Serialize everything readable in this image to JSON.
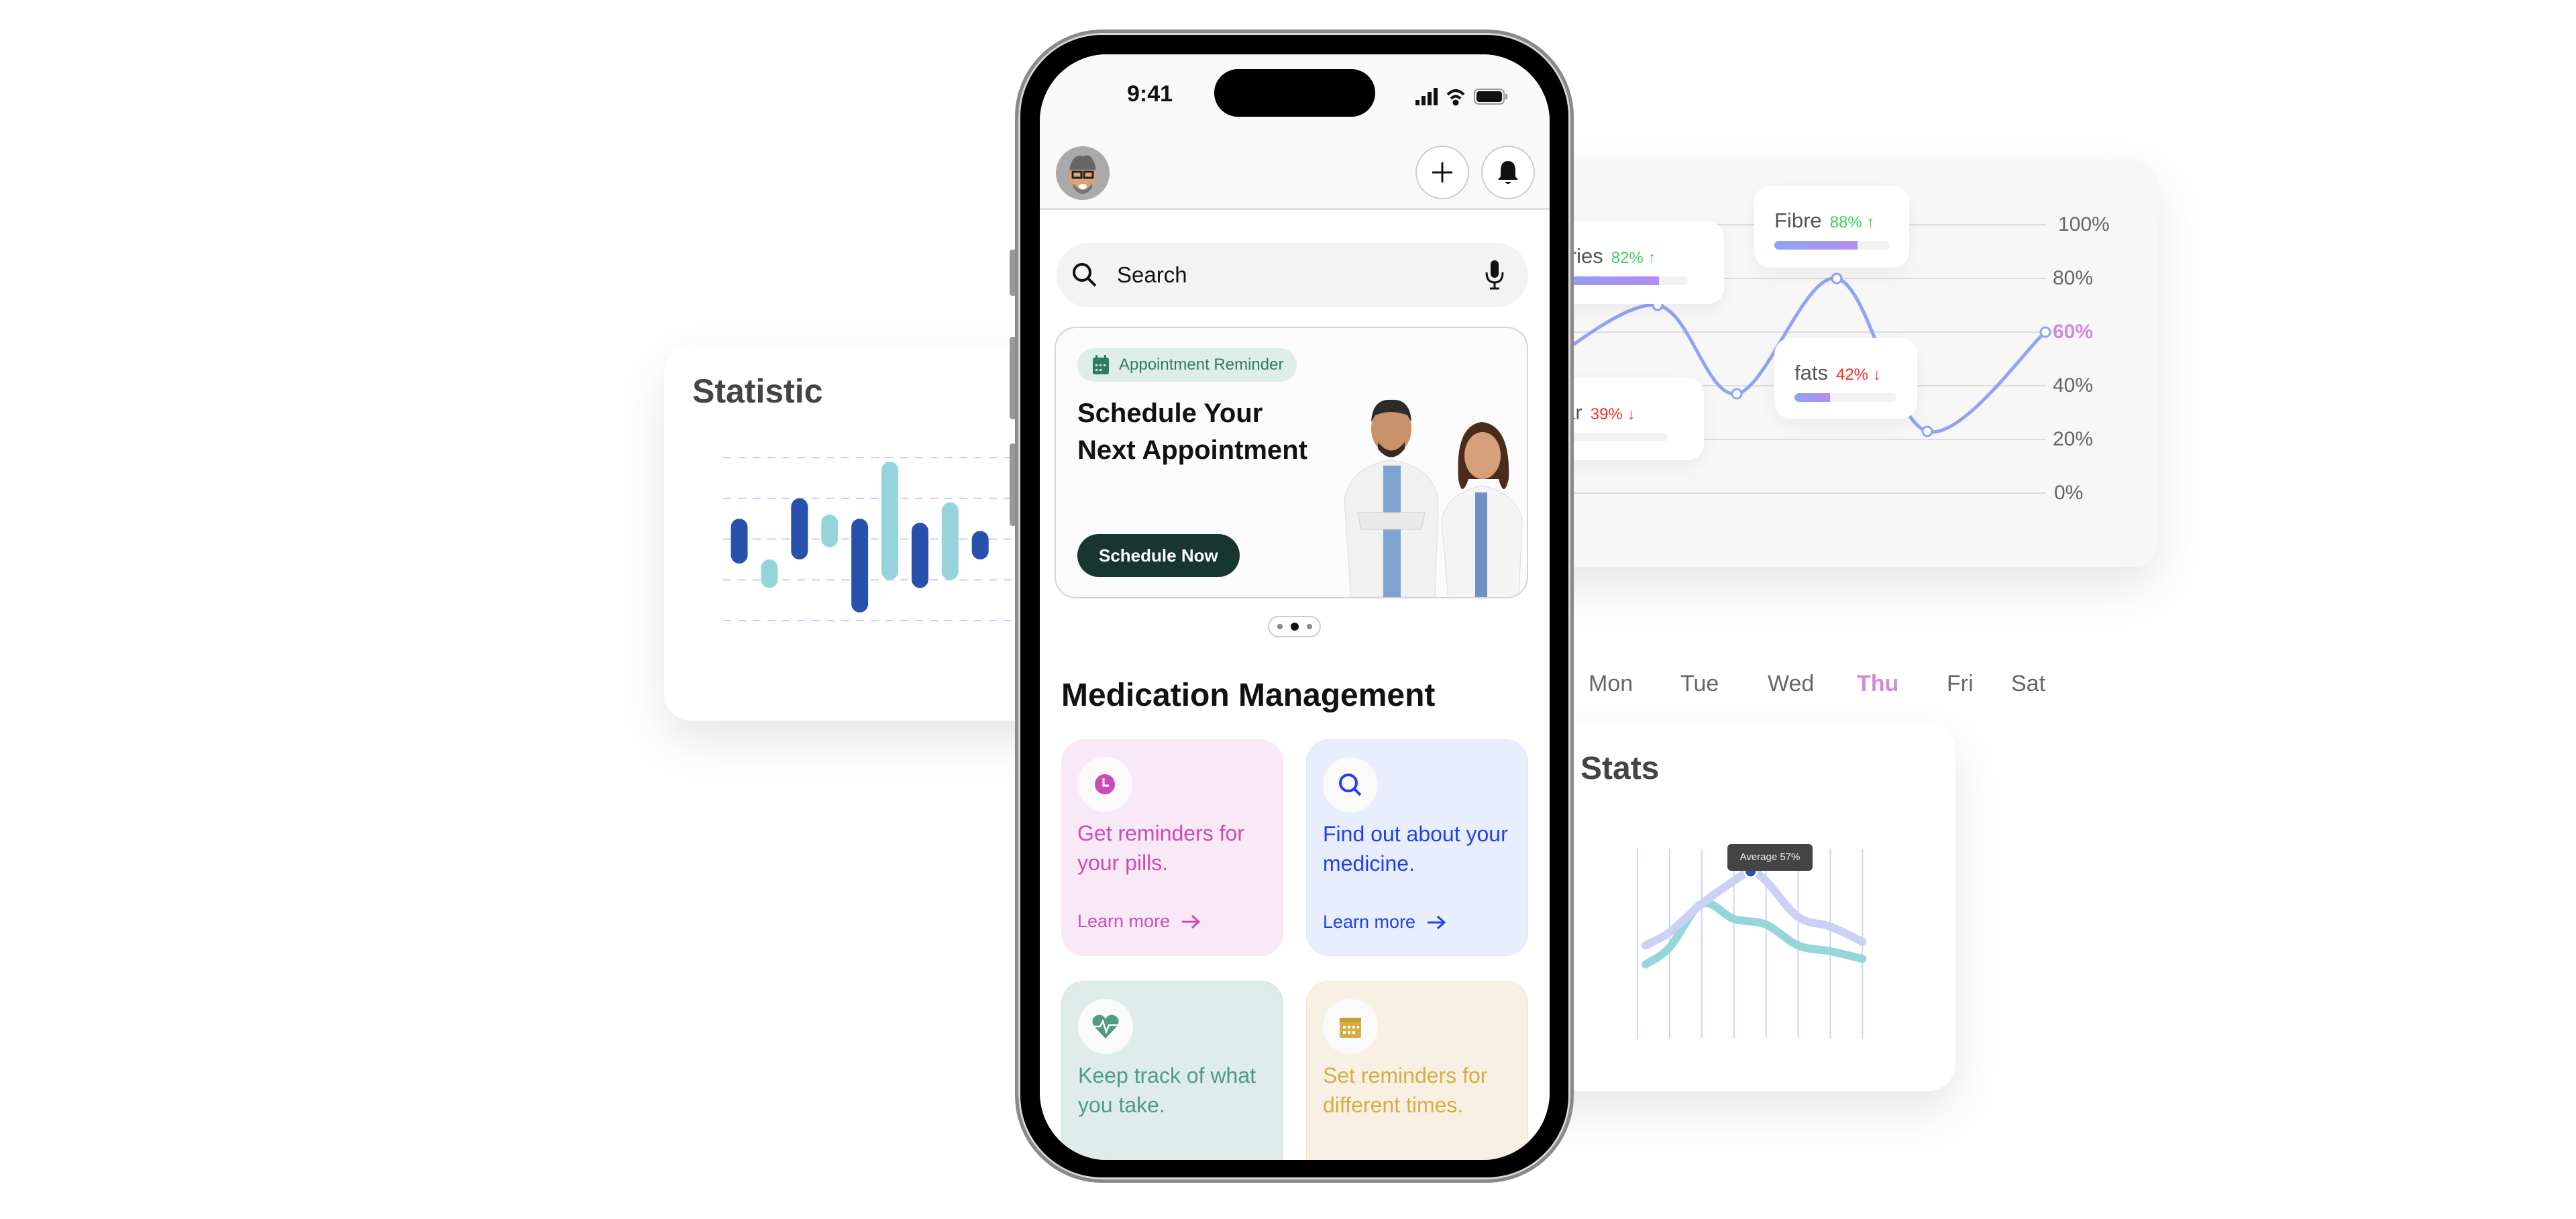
{
  "statistic_card": {
    "title": "Statistic",
    "chart_data": {
      "type": "bar",
      "subtype": "floating-range",
      "gridlines": 5,
      "grid": "dashed-horizontal",
      "colors": [
        "#2751ab",
        "#94d4da"
      ],
      "ranges": [
        [
          1.4,
          2.5
        ],
        [
          0.8,
          1.5
        ],
        [
          1.5,
          3.0
        ],
        [
          1.8,
          2.6
        ],
        [
          0.2,
          2.5
        ],
        [
          1.0,
          3.9
        ],
        [
          0.8,
          2.4
        ],
        [
          1.0,
          2.9
        ],
        [
          1.5,
          2.2
        ]
      ]
    }
  },
  "nutrition_card": {
    "chart_data": {
      "type": "line",
      "y_ticks": [
        "100%",
        "80%",
        "60%",
        "40%",
        "20%",
        "0%"
      ],
      "ylim": [
        0,
        100
      ],
      "highlight_tick": "60%",
      "x_labels": [
        "Mon",
        "Tue",
        "Wed",
        "Thu",
        "Fri",
        "Sat"
      ],
      "highlight_day": "Thu",
      "values": [
        48,
        70,
        37,
        80,
        23,
        60
      ],
      "line_color": "#8fa3f7",
      "highlight_color": "#d08be0"
    },
    "tooltips": [
      {
        "label": "Calories",
        "value": "82%",
        "trend": "up",
        "arrow": "↑",
        "fill": 82
      },
      {
        "label": "Fibre",
        "value": "88%",
        "trend": "up",
        "arrow": "↑",
        "fill": 72
      },
      {
        "label": "Sugar",
        "value": "39%",
        "trend": "down",
        "arrow": "↓",
        "fill": 30
      },
      {
        "label": "fats",
        "value": "42%",
        "trend": "down",
        "arrow": "↓",
        "fill": 35
      }
    ],
    "up_color": "#3fcf5a",
    "down_color": "#f0302a"
  },
  "stats_card": {
    "title": "Stats",
    "tooltip": "Average 57%",
    "chart_data": {
      "type": "line",
      "grid": "vertical",
      "series": [
        {
          "color": "#cdd0f5",
          "values": [
            49,
            56,
            71,
            83,
            88,
            83,
            64,
            59,
            51
          ]
        },
        {
          "color": "#95d6da",
          "values": [
            39,
            48,
            71,
            63,
            60,
            49,
            46,
            42
          ]
        }
      ]
    }
  },
  "phone": {
    "status": {
      "time": "9:41"
    },
    "search": {
      "placeholder": "Search"
    },
    "banner": {
      "badge": "Appointment Reminder",
      "title_line1": "Schedule Your",
      "title_line2": "Next Appointment",
      "cta": "Schedule Now",
      "page_index": 2,
      "page_count": 3
    },
    "section_title": "Medication Management",
    "cards": [
      {
        "text": "Get reminders for your pills.",
        "link": "Learn more",
        "icon": "clock-icon",
        "bg": "#f9e8f6",
        "color": "#c94db9"
      },
      {
        "text": "Find out about your medicine.",
        "link": "Learn more",
        "icon": "search-icon",
        "bg": "#e8eefe",
        "color": "#1f3ff0"
      },
      {
        "text": "Keep track of what you take.",
        "icon": "heart-pulse-icon",
        "bg": "#deede9",
        "color": "#4f9a83"
      },
      {
        "text": "Set reminders for different times.",
        "icon": "calendar-icon",
        "bg": "#f8f1e3",
        "color": "#d4ad45"
      }
    ]
  }
}
